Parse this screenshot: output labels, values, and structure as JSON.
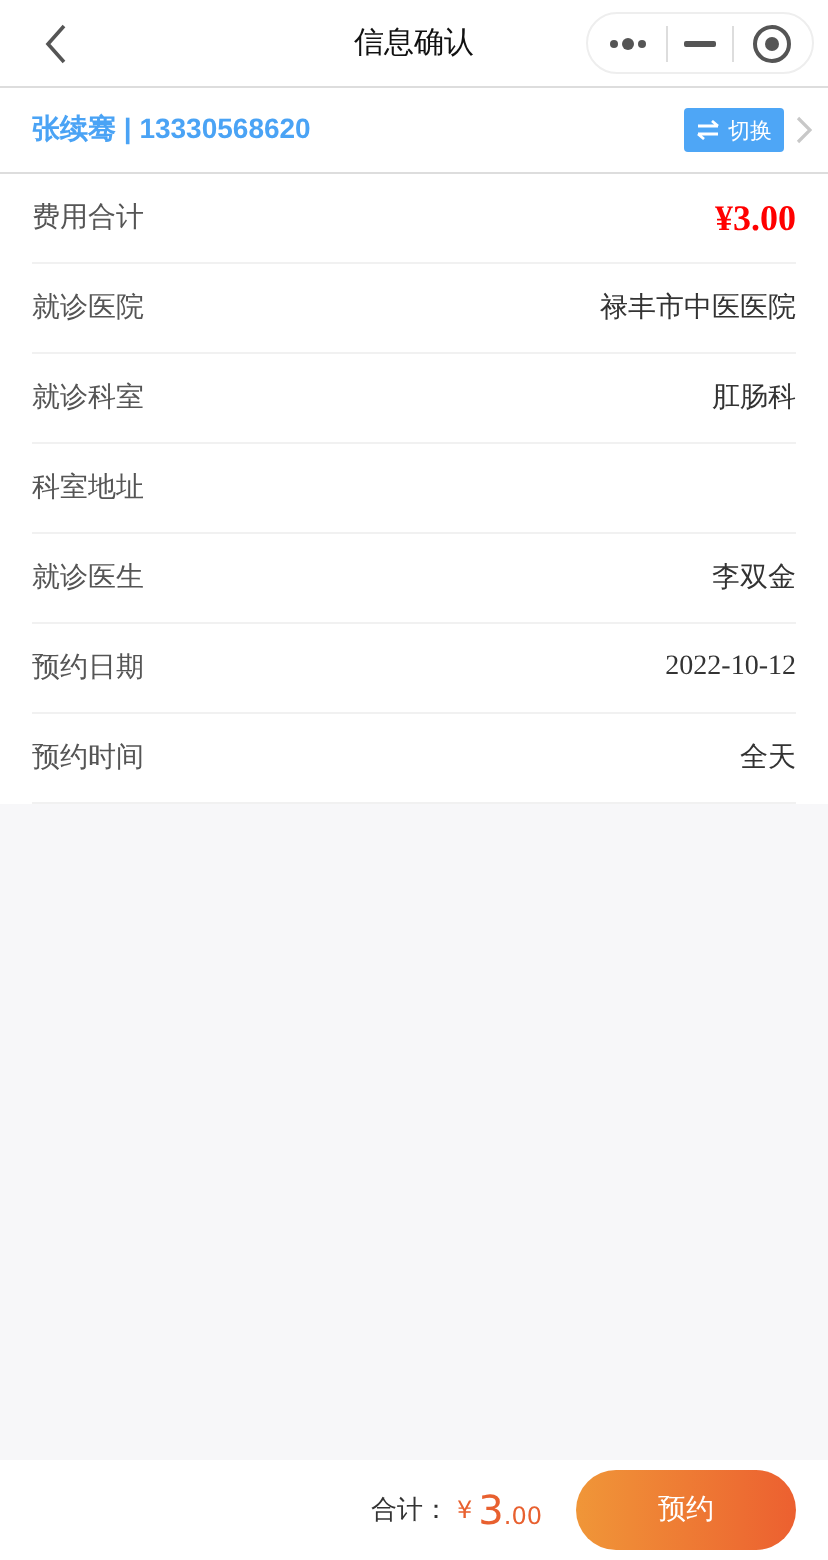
{
  "nav": {
    "title": "信息确认"
  },
  "patient": {
    "name_phone": "张续骞 | 13330568620",
    "switch_label": "切换"
  },
  "rows": [
    {
      "label": "费用合计",
      "value": "¥3.00",
      "kind": "price"
    },
    {
      "label": "就诊医院",
      "value": "禄丰市中医医院",
      "kind": "text"
    },
    {
      "label": "就诊科室",
      "value": "肛肠科",
      "kind": "text"
    },
    {
      "label": "科室地址"
    },
    {
      "label": "就诊医生",
      "value": "李双金",
      "kind": "text"
    },
    {
      "label": "预约日期",
      "value": "2022-10-12",
      "kind": "date"
    },
    {
      "label": "预约时间",
      "value": "全天",
      "kind": "text"
    }
  ],
  "footer": {
    "total_label": "合计：",
    "currency": "¥",
    "amount_int": "3",
    "amount_dec": ".00",
    "submit": "预约"
  }
}
